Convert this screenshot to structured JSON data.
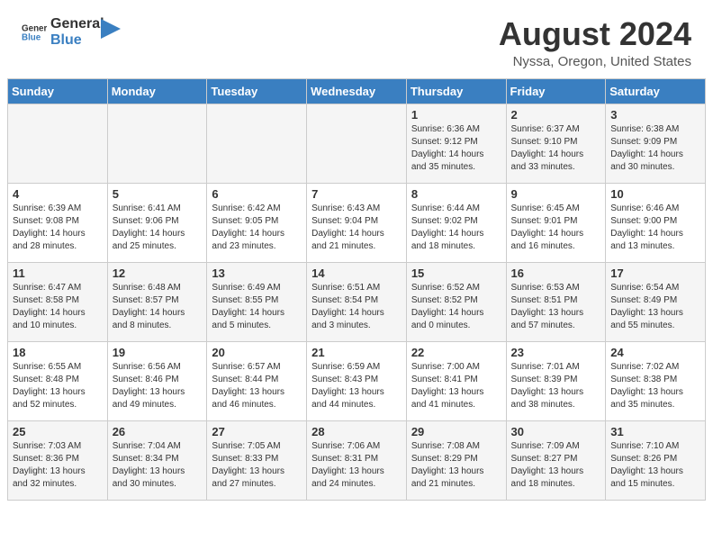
{
  "header": {
    "logo_line1": "General",
    "logo_line2": "Blue",
    "main_title": "August 2024",
    "subtitle": "Nyssa, Oregon, United States"
  },
  "calendar": {
    "days_of_week": [
      "Sunday",
      "Monday",
      "Tuesday",
      "Wednesday",
      "Thursday",
      "Friday",
      "Saturday"
    ],
    "weeks": [
      [
        {
          "day": "",
          "info": ""
        },
        {
          "day": "",
          "info": ""
        },
        {
          "day": "",
          "info": ""
        },
        {
          "day": "",
          "info": ""
        },
        {
          "day": "1",
          "info": "Sunrise: 6:36 AM\nSunset: 9:12 PM\nDaylight: 14 hours\nand 35 minutes."
        },
        {
          "day": "2",
          "info": "Sunrise: 6:37 AM\nSunset: 9:10 PM\nDaylight: 14 hours\nand 33 minutes."
        },
        {
          "day": "3",
          "info": "Sunrise: 6:38 AM\nSunset: 9:09 PM\nDaylight: 14 hours\nand 30 minutes."
        }
      ],
      [
        {
          "day": "4",
          "info": "Sunrise: 6:39 AM\nSunset: 9:08 PM\nDaylight: 14 hours\nand 28 minutes."
        },
        {
          "day": "5",
          "info": "Sunrise: 6:41 AM\nSunset: 9:06 PM\nDaylight: 14 hours\nand 25 minutes."
        },
        {
          "day": "6",
          "info": "Sunrise: 6:42 AM\nSunset: 9:05 PM\nDaylight: 14 hours\nand 23 minutes."
        },
        {
          "day": "7",
          "info": "Sunrise: 6:43 AM\nSunset: 9:04 PM\nDaylight: 14 hours\nand 21 minutes."
        },
        {
          "day": "8",
          "info": "Sunrise: 6:44 AM\nSunset: 9:02 PM\nDaylight: 14 hours\nand 18 minutes."
        },
        {
          "day": "9",
          "info": "Sunrise: 6:45 AM\nSunset: 9:01 PM\nDaylight: 14 hours\nand 16 minutes."
        },
        {
          "day": "10",
          "info": "Sunrise: 6:46 AM\nSunset: 9:00 PM\nDaylight: 14 hours\nand 13 minutes."
        }
      ],
      [
        {
          "day": "11",
          "info": "Sunrise: 6:47 AM\nSunset: 8:58 PM\nDaylight: 14 hours\nand 10 minutes."
        },
        {
          "day": "12",
          "info": "Sunrise: 6:48 AM\nSunset: 8:57 PM\nDaylight: 14 hours\nand 8 minutes."
        },
        {
          "day": "13",
          "info": "Sunrise: 6:49 AM\nSunset: 8:55 PM\nDaylight: 14 hours\nand 5 minutes."
        },
        {
          "day": "14",
          "info": "Sunrise: 6:51 AM\nSunset: 8:54 PM\nDaylight: 14 hours\nand 3 minutes."
        },
        {
          "day": "15",
          "info": "Sunrise: 6:52 AM\nSunset: 8:52 PM\nDaylight: 14 hours\nand 0 minutes."
        },
        {
          "day": "16",
          "info": "Sunrise: 6:53 AM\nSunset: 8:51 PM\nDaylight: 13 hours\nand 57 minutes."
        },
        {
          "day": "17",
          "info": "Sunrise: 6:54 AM\nSunset: 8:49 PM\nDaylight: 13 hours\nand 55 minutes."
        }
      ],
      [
        {
          "day": "18",
          "info": "Sunrise: 6:55 AM\nSunset: 8:48 PM\nDaylight: 13 hours\nand 52 minutes."
        },
        {
          "day": "19",
          "info": "Sunrise: 6:56 AM\nSunset: 8:46 PM\nDaylight: 13 hours\nand 49 minutes."
        },
        {
          "day": "20",
          "info": "Sunrise: 6:57 AM\nSunset: 8:44 PM\nDaylight: 13 hours\nand 46 minutes."
        },
        {
          "day": "21",
          "info": "Sunrise: 6:59 AM\nSunset: 8:43 PM\nDaylight: 13 hours\nand 44 minutes."
        },
        {
          "day": "22",
          "info": "Sunrise: 7:00 AM\nSunset: 8:41 PM\nDaylight: 13 hours\nand 41 minutes."
        },
        {
          "day": "23",
          "info": "Sunrise: 7:01 AM\nSunset: 8:39 PM\nDaylight: 13 hours\nand 38 minutes."
        },
        {
          "day": "24",
          "info": "Sunrise: 7:02 AM\nSunset: 8:38 PM\nDaylight: 13 hours\nand 35 minutes."
        }
      ],
      [
        {
          "day": "25",
          "info": "Sunrise: 7:03 AM\nSunset: 8:36 PM\nDaylight: 13 hours\nand 32 minutes."
        },
        {
          "day": "26",
          "info": "Sunrise: 7:04 AM\nSunset: 8:34 PM\nDaylight: 13 hours\nand 30 minutes."
        },
        {
          "day": "27",
          "info": "Sunrise: 7:05 AM\nSunset: 8:33 PM\nDaylight: 13 hours\nand 27 minutes."
        },
        {
          "day": "28",
          "info": "Sunrise: 7:06 AM\nSunset: 8:31 PM\nDaylight: 13 hours\nand 24 minutes."
        },
        {
          "day": "29",
          "info": "Sunrise: 7:08 AM\nSunset: 8:29 PM\nDaylight: 13 hours\nand 21 minutes."
        },
        {
          "day": "30",
          "info": "Sunrise: 7:09 AM\nSunset: 8:27 PM\nDaylight: 13 hours\nand 18 minutes."
        },
        {
          "day": "31",
          "info": "Sunrise: 7:10 AM\nSunset: 8:26 PM\nDaylight: 13 hours\nand 15 minutes."
        }
      ]
    ]
  }
}
